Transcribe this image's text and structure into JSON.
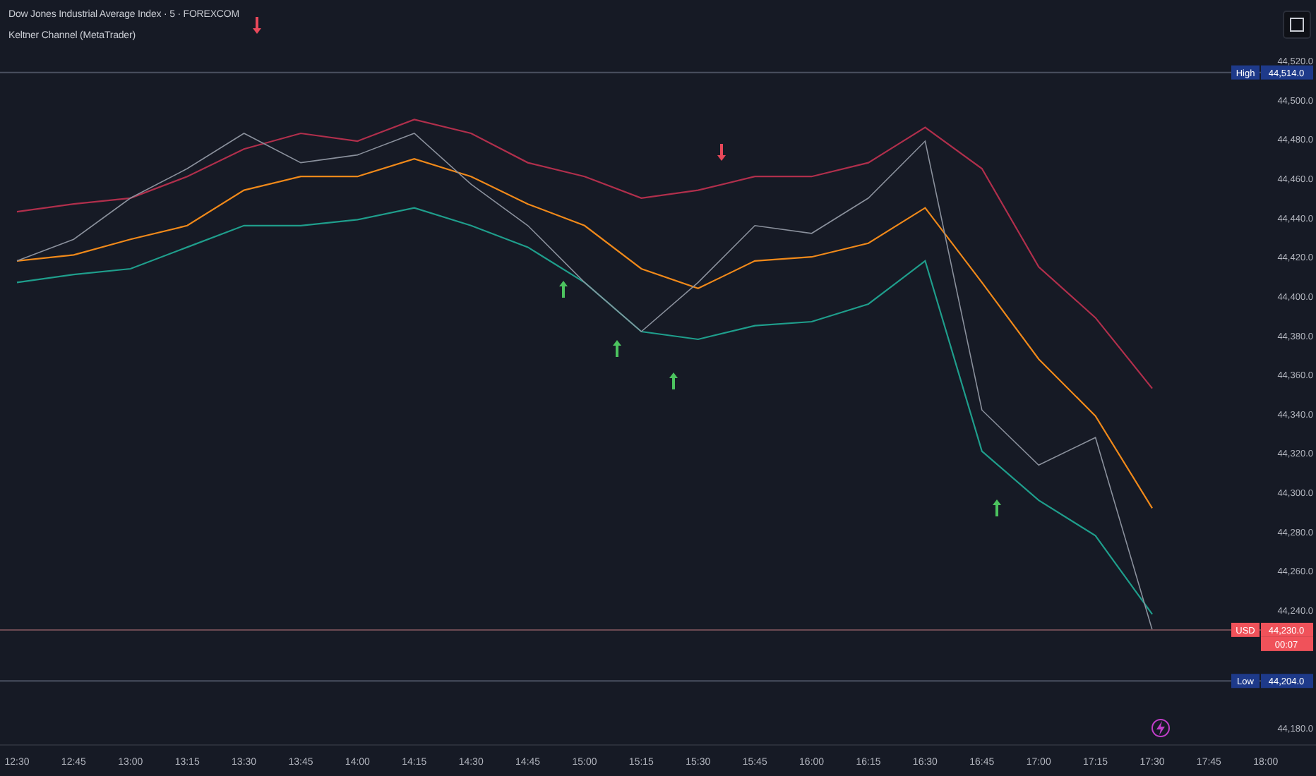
{
  "legend": {
    "title": "Dow Jones Industrial Average Index · 5 · FOREXCOM",
    "indicator": "Keltner Channel (MetaTrader)"
  },
  "chart": {
    "chart_data": {
      "type": "line",
      "x": [
        "12:30",
        "12:45",
        "13:00",
        "13:15",
        "13:30",
        "13:45",
        "14:00",
        "14:15",
        "14:30",
        "14:45",
        "15:00",
        "15:15",
        "15:30",
        "15:45",
        "16:00",
        "16:15",
        "16:30",
        "16:45",
        "17:00",
        "17:15",
        "17:30",
        "17:45",
        "18:00"
      ],
      "series": [
        {
          "color": "#b02f4c",
          "values": [
            44443,
            44447,
            44450,
            44461,
            44475,
            44483,
            44479,
            44490,
            44483,
            44468,
            44461,
            44450,
            44454,
            44461,
            44461,
            44468,
            44486,
            44465,
            44415,
            44389,
            44353,
            null,
            null
          ]
        },
        {
          "color": "#f0891a",
          "values": [
            44418,
            44421,
            44429,
            44436,
            44454,
            44461,
            44461,
            44470,
            44461,
            44447,
            44436,
            44414,
            44404,
            44418,
            44420,
            44427,
            44445,
            44407,
            44368,
            44339,
            44292,
            null,
            null
          ]
        },
        {
          "color": "#1f9e8c",
          "values": [
            44407,
            44411,
            44414,
            44425,
            44436,
            44436,
            44439,
            44445,
            44436,
            44425,
            44407,
            44382,
            44378,
            44385,
            44387,
            44396,
            44418,
            44321,
            44296,
            44278,
            44238,
            null,
            null
          ]
        },
        {
          "color": "#8a909c",
          "values": [
            44418,
            44429,
            44450,
            44465,
            44483,
            44468,
            44472,
            44483,
            44457,
            44436,
            44407,
            44382,
            44407,
            44436,
            44432,
            44450,
            44479,
            44342,
            44314,
            44328,
            44230,
            null,
            null
          ]
        }
      ],
      "ylim": [
        44180,
        44520
      ],
      "yticks": [
        {
          "value": 44520,
          "label": "44,520.0"
        },
        {
          "value": 44500,
          "label": "44,500.0"
        },
        {
          "value": 44480,
          "label": "44,480.0"
        },
        {
          "value": 44460,
          "label": "44,460.0"
        },
        {
          "value": 44440,
          "label": "44,440.0"
        },
        {
          "value": 44420,
          "label": "44,420.0"
        },
        {
          "value": 44400,
          "label": "44,400.0"
        },
        {
          "value": 44380,
          "label": "44,380.0"
        },
        {
          "value": 44360,
          "label": "44,360.0"
        },
        {
          "value": 44340,
          "label": "44,340.0"
        },
        {
          "value": 44320,
          "label": "44,320.0"
        },
        {
          "value": 44300,
          "label": "44,300.0"
        },
        {
          "value": 44280,
          "label": "44,280.0"
        },
        {
          "value": 44260,
          "label": "44,260.0"
        },
        {
          "value": 44240,
          "label": "44,240.0"
        },
        {
          "value": 44180,
          "label": "44,180.0"
        }
      ],
      "ref_lines": [
        {
          "axis": "y",
          "value": 44514,
          "label": "44,514.0"
        },
        {
          "axis": "y",
          "value": 44230,
          "label": "44,230.0"
        },
        {
          "axis": "y",
          "value": 44204,
          "label": "44,204.0"
        }
      ]
    }
  },
  "price_tags": [
    {
      "kind": "high",
      "tag": "High"
    },
    {
      "kind": "last",
      "tag": "USD",
      "countdown": "00:07"
    },
    {
      "kind": "low",
      "tag": "Low"
    }
  ],
  "signals": [
    {
      "kind": "down"
    },
    {
      "kind": "up"
    },
    {
      "kind": "up"
    },
    {
      "kind": "up"
    },
    {
      "kind": "down"
    },
    {
      "kind": "up"
    }
  ]
}
